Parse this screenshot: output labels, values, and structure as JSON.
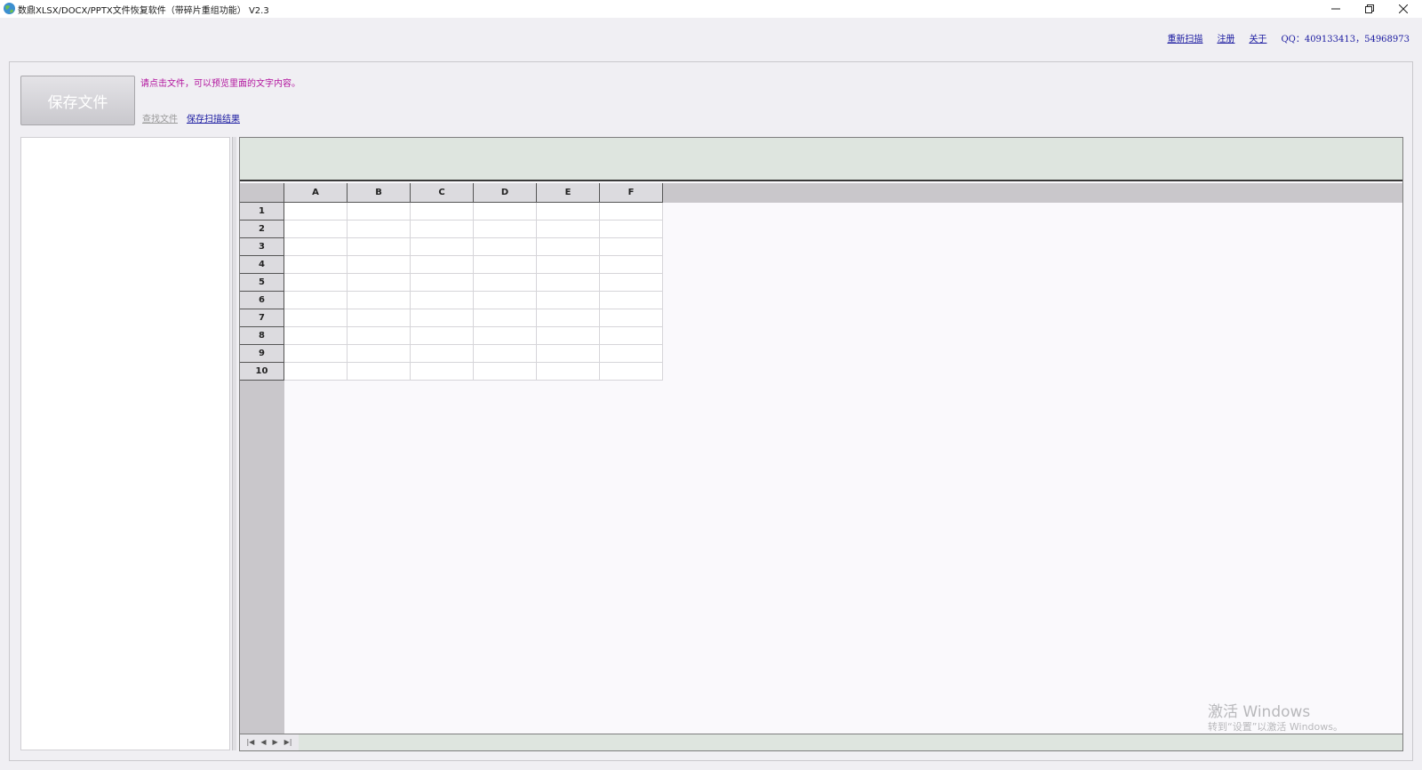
{
  "window": {
    "title": "数鼎XLSX/DOCX/PPTX文件恢复软件（带碎片重组功能） V2.3",
    "icon": "app-globe-icon"
  },
  "top_links": {
    "rescan": "重新扫描",
    "register": "注册",
    "about": "关于",
    "qq": "QQ：409133413，54968973"
  },
  "toolbar": {
    "save_file_label": "保存文件",
    "hint": "请点击文件，可以预览里面的文字内容。",
    "find_file_label": "查找文件",
    "save_scan_result_label": "保存扫描结果"
  },
  "spreadsheet": {
    "columns": [
      "A",
      "B",
      "C",
      "D",
      "E",
      "F"
    ],
    "rows": [
      "1",
      "2",
      "3",
      "4",
      "5",
      "6",
      "7",
      "8",
      "9",
      "10"
    ],
    "sheet_nav": [
      "first",
      "prev",
      "next",
      "last"
    ]
  },
  "watermark": {
    "title": "激活 Windows",
    "subtitle": "转到“设置”以激活 Windows。"
  },
  "colors": {
    "link": "#1a1aa0",
    "hint": "#b2149e",
    "formula_area": "#dee5df",
    "header_band": "#c9c7cb"
  }
}
